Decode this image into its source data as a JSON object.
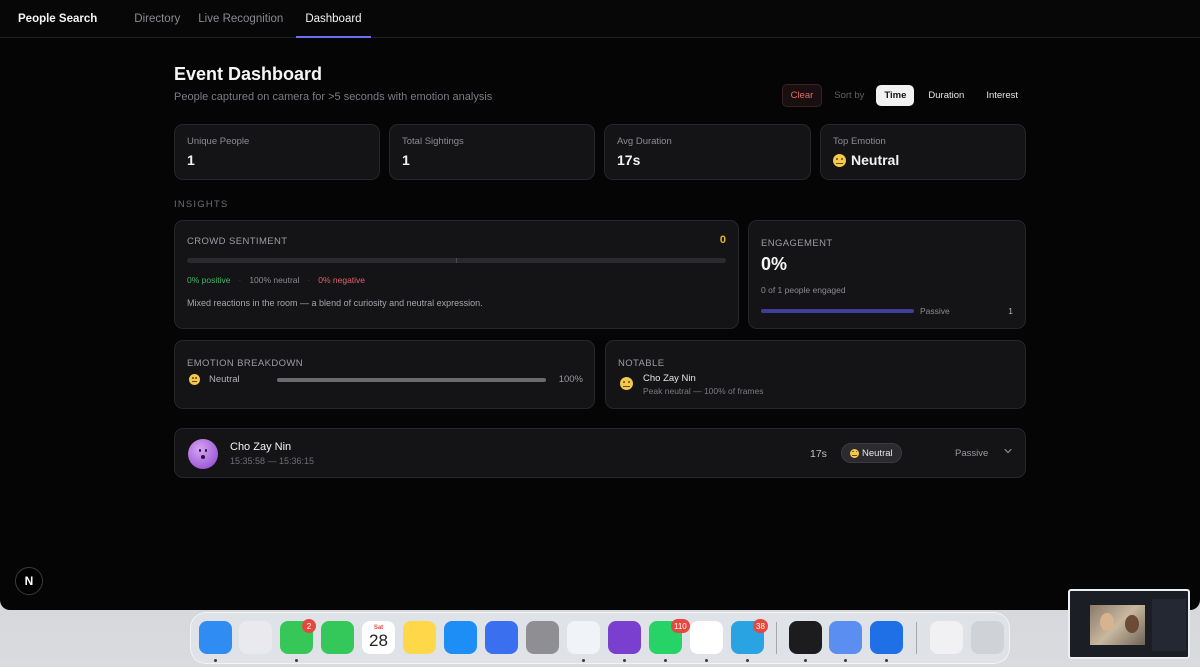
{
  "nav": {
    "brand": "People Search",
    "tabs": [
      "Directory",
      "Live Recognition",
      "Dashboard"
    ],
    "active_tab": "Dashboard"
  },
  "header": {
    "title": "Event Dashboard",
    "subtitle": "People captured on camera for >5 seconds with emotion analysis"
  },
  "sort": {
    "clear_label": "Clear",
    "label": "Sort by",
    "options": [
      "Time",
      "Duration",
      "Interest"
    ],
    "active": "Time"
  },
  "stats": [
    {
      "label": "Unique People",
      "value": "1"
    },
    {
      "label": "Total Sightings",
      "value": "1"
    },
    {
      "label": "Avg Duration",
      "value": "17s"
    },
    {
      "label": "Top Emotion",
      "value": "Neutral",
      "icon": "neutral-face-icon"
    }
  ],
  "insights_label": "INSIGHTS",
  "crowd": {
    "title": "CROWD SENTIMENT",
    "score": "0",
    "positive": "0% positive",
    "neutral": "100% neutral",
    "negative": "0% negative",
    "summary": "Mixed reactions in the room — a blend of curiosity and neutral expression."
  },
  "engagement": {
    "title": "ENGAGEMENT",
    "value": "0%",
    "subtitle": "0 of 1 people engaged",
    "bar_label": "Passive",
    "bar_count": "1",
    "bar_fraction": 1.0
  },
  "emotion_breakdown": {
    "title": "EMOTION BREAKDOWN",
    "rows": [
      {
        "name": "Neutral",
        "percent": "100%",
        "fraction": 1.0,
        "icon": "neutral-face-icon"
      }
    ]
  },
  "notable": {
    "title": "NOTABLE",
    "name": "Cho Zay Nin",
    "detail": "Peak neutral — 100% of frames"
  },
  "people": [
    {
      "name": "Cho Zay Nin",
      "time_range": "15:35:58 — 15:36:15",
      "duration": "17s",
      "emotion": "Neutral",
      "state": "Passive"
    }
  ],
  "footer_badge": "N",
  "dock": {
    "apps": [
      {
        "name": "Finder",
        "color": "#2f8cf2"
      },
      {
        "name": "Launchpad",
        "color": "#e9e9ee"
      },
      {
        "name": "Messages",
        "color": "#37c759",
        "badge": "2"
      },
      {
        "name": "FaceTime",
        "color": "#34c759"
      },
      {
        "name": "Calendar",
        "color": "#ffffff",
        "day": "Sat",
        "date": "28"
      },
      {
        "name": "Notes",
        "color": "#ffd84a"
      },
      {
        "name": "App Store",
        "color": "#1c8ef5"
      },
      {
        "name": "Simulator",
        "color": "#3a6ff0"
      },
      {
        "name": "System Settings",
        "color": "#8e8e93"
      },
      {
        "name": "VS Code",
        "color": "#f0f4f8"
      },
      {
        "name": "GitHub Desktop",
        "color": "#7b3fd0"
      },
      {
        "name": "WhatsApp",
        "color": "#25d366",
        "badge": "110"
      },
      {
        "name": "Chrome",
        "color": "#ffffff"
      },
      {
        "name": "Telegram",
        "color": "#2aa3e3",
        "badge": "38"
      },
      {
        "name": "Terminal",
        "color": "#1c1c1e"
      },
      {
        "name": "Camera Utility",
        "color": "#5a8ef0"
      },
      {
        "name": "QuickTime",
        "color": "#1f6fe6"
      },
      {
        "name": "Document",
        "color": "#f1f1f3"
      },
      {
        "name": "Trash",
        "color": "#cfd3d8"
      }
    ]
  },
  "colors": {
    "accent": "#6d6ff0",
    "score": "#f0b429",
    "positive": "#3fb56a",
    "negative": "#e0616c",
    "clear": "#e36a6a"
  }
}
